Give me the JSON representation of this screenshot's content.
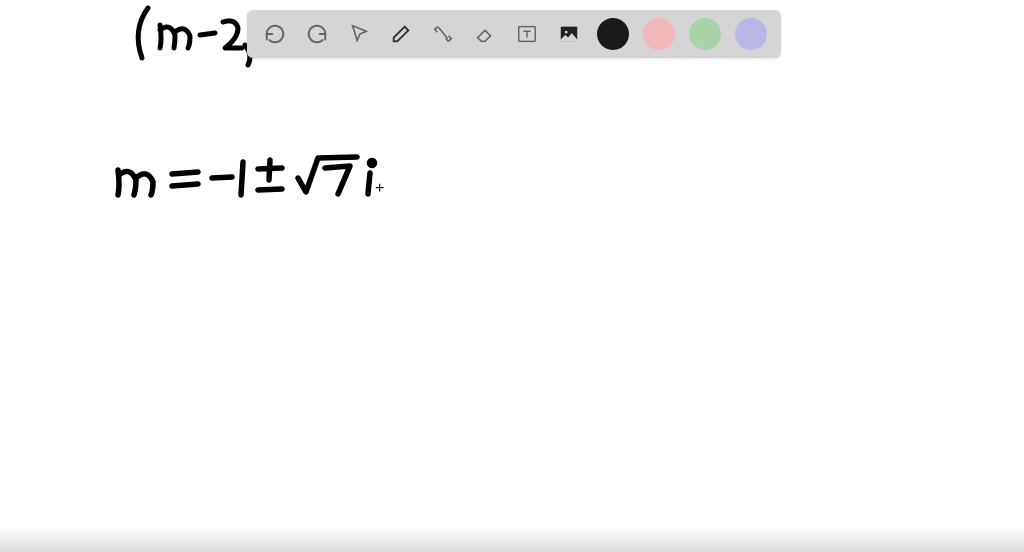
{
  "toolbar": {
    "undo": "undo",
    "redo": "redo",
    "pointer": "pointer",
    "pen": "pen",
    "tools": "tools",
    "eraser": "eraser",
    "text": "text",
    "image": "image"
  },
  "colors": {
    "black": "#1a1a1a",
    "pink": "#f0b8b8",
    "green": "#a8d4a8",
    "purple": "#b8b8e8"
  },
  "handwriting": {
    "line1": "(m-2)",
    "line2": "m = -1 ± √7 i"
  }
}
